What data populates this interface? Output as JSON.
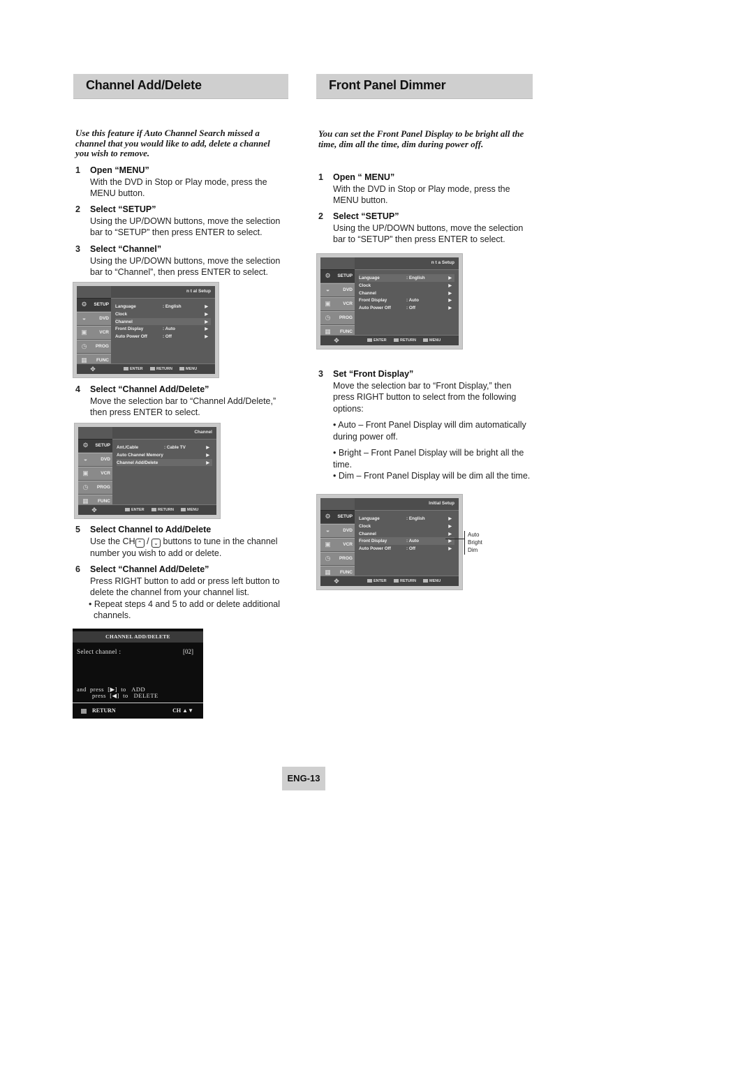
{
  "left": {
    "title": "Channel Add/Delete",
    "intro": "Use this feature if Auto Channel Search missed a channel that you would like to add, delete a channel you wish to remove.",
    "steps": [
      {
        "num": "1",
        "head": "Open “MENU”",
        "body": "With the DVD in Stop or Play mode, press the MENU button."
      },
      {
        "num": "2",
        "head": "Select “SETUP”",
        "body": "Using the UP/DOWN  buttons, move the selection bar to “SETUP” then press ENTER to select."
      },
      {
        "num": "3",
        "head": "Select “Channel”",
        "body": "Using the UP/DOWN buttons, move the selection bar to “Channel”, then press ENTER to select."
      },
      {
        "num": "4",
        "head": "Select “Channel Add/Delete”",
        "body": "Move the selection bar to “Channel Add/Delete,” then press ENTER to select."
      },
      {
        "num": "5",
        "head": "Select Channel to Add/Delete",
        "body_pre": "Use the CH",
        "body_sep": " / ",
        "body_post": " buttons to tune in the channel number you wish to add or delete.",
        "up_icon": "⌃",
        "down_icon": "⌄"
      },
      {
        "num": "6",
        "head": "Select “Channel Add/Delete”",
        "body": "Press RIGHT button to add or press left button to delete the channel from your channel list.",
        "bullet": "• Repeat steps 4 and 5 to add or delete additional channels."
      }
    ],
    "osd_setup": {
      "title": "n t al Setup",
      "side": [
        "SETUP",
        "DVD",
        "VCR",
        "PROG",
        "FUNC"
      ],
      "rows": [
        {
          "k": "Language",
          "v": ": English",
          "ar": "▶"
        },
        {
          "k": "Clock",
          "v": "",
          "ar": "▶"
        },
        {
          "k": "Channel",
          "v": "",
          "ar": "▶"
        },
        {
          "k": "Front Display",
          "v": ": Auto",
          "ar": "▶"
        },
        {
          "k": "Auto Power Off",
          "v": ": Off",
          "ar": "▶"
        }
      ],
      "footer": [
        "ENTER",
        "RETURN",
        "MENU"
      ]
    },
    "osd_channel": {
      "title": "Channel",
      "side": [
        "SETUP",
        "DVD",
        "VCR",
        "PROG",
        "FUNC"
      ],
      "rows": [
        {
          "k": "Ant./Cable",
          "v": ": Cable TV",
          "ar": "▶"
        },
        {
          "k": "Auto Channel Memory",
          "v": "",
          "ar": "▶"
        },
        {
          "k": "Channel Add/Delete",
          "v": "",
          "ar": "▶"
        }
      ],
      "footer": [
        "ENTER",
        "RETURN",
        "MENU"
      ]
    },
    "osd_add_delete": {
      "header": "CHANNEL ADD/DELETE",
      "select_label": "Select channel :",
      "channel_value": "[02]",
      "line1": "and  press  [▶]  to   ADD",
      "line2": "press  [◀]  to   DELETE",
      "return_label": "RETURN",
      "ch_label": "CH ▲▼"
    }
  },
  "right": {
    "title": "Front Panel Dimmer",
    "intro": "You can set the Front Panel Display to be bright all the time, dim all the time, dim during power off.",
    "steps": [
      {
        "num": "1",
        "head": "Open “ MENU”",
        "body": "With the DVD in Stop or Play mode, press the MENU button."
      },
      {
        "num": "2",
        "head": "Select “SETUP”",
        "body": "Using the UP/DOWN  buttons, move the selection bar to “SETUP” then press ENTER to select."
      },
      {
        "num": "3",
        "head": "Set “Front Display”",
        "body": "Move the selection bar to “Front Display,” then press RIGHT button to select from the following options:"
      }
    ],
    "options": [
      {
        "label": "• Auto –",
        "text": "Front Panel Display will dim automatically during power off."
      },
      {
        "label": "• Bright –",
        "text": "Front Panel Display will be bright all the time."
      },
      {
        "label": "• Dim –",
        "text": "Front Panel Display will be dim all the time."
      }
    ],
    "osd_setup_a": {
      "title": "n t a  Setup",
      "side": [
        "SETUP",
        "DVD",
        "VCR",
        "PROG",
        "FUNC"
      ],
      "rows": [
        {
          "k": "Language",
          "v": ": English",
          "ar": "▶"
        },
        {
          "k": "Clock",
          "v": "",
          "ar": "▶"
        },
        {
          "k": "Channel",
          "v": "",
          "ar": "▶"
        },
        {
          "k": "Front Display",
          "v": ": Auto",
          "ar": "▶"
        },
        {
          "k": "Auto Power Off",
          "v": ": Off",
          "ar": "▶"
        }
      ],
      "footer": [
        "ENTER",
        "RETURN",
        "MENU"
      ]
    },
    "osd_setup_b": {
      "title": "Initial Setup",
      "side": [
        "SETUP",
        "DVD",
        "VCR",
        "PROG",
        "FUNC"
      ],
      "rows": [
        {
          "k": "Language",
          "v": ": English",
          "ar": "▶"
        },
        {
          "k": "Clock",
          "v": "",
          "ar": "▶"
        },
        {
          "k": "Channel",
          "v": "",
          "ar": "▶"
        },
        {
          "k": "Front Display",
          "v": ": Auto",
          "ar": "▶"
        },
        {
          "k": "Auto Power Off",
          "v": ": Off",
          "ar": "▶"
        }
      ],
      "footer": [
        "ENTER",
        "RETURN",
        "MENU"
      ],
      "callout": [
        "Auto",
        "Bright",
        "Dim"
      ]
    }
  },
  "page_number": "ENG-13",
  "icons": {
    "setup": "⚙",
    "dvd": "◒",
    "vcr": "▣",
    "prog": "◷",
    "func": "▦",
    "nav": "✥"
  }
}
